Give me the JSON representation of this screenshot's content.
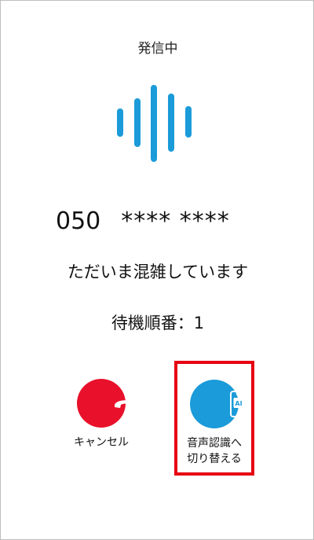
{
  "call": {
    "status": "発信中",
    "number_prefix": "050",
    "number_masked": "**** ****",
    "busy_message": "ただいま混雑しています",
    "queue_text": "待機順番：1"
  },
  "actions": {
    "cancel_label": "キャンセル",
    "voice_label_line1": "音声認識へ",
    "voice_label_line2": "切り替える",
    "voice_icon_text": "AI"
  },
  "colors": {
    "accent_blue": "#1b9bd9",
    "cancel_red": "#e8102a",
    "highlight_red": "#e60012"
  }
}
